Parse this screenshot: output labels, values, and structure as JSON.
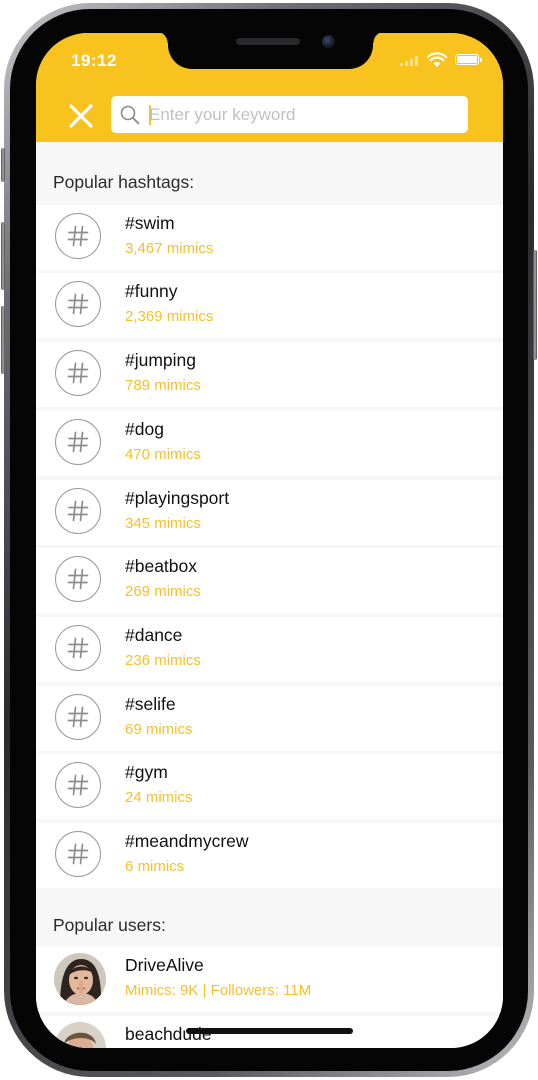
{
  "status_bar": {
    "time": "19:12"
  },
  "search": {
    "placeholder": "Enter your keyword"
  },
  "icons": {
    "close": "close-icon",
    "search": "search-icon",
    "hashtag": "hashtag-icon",
    "wifi": "wifi-icon",
    "battery": "battery-icon",
    "signal": "cellular-signal-icon"
  },
  "colors": {
    "accent": "#f8c21f",
    "count_text": "#f4c02c",
    "background": "#f7f7f7"
  },
  "hashtags_section": {
    "title": "Popular hashtags:"
  },
  "hashtags": [
    {
      "tag": "#swim",
      "count": "3,467 mimics"
    },
    {
      "tag": "#funny",
      "count": "2,369 mimics"
    },
    {
      "tag": "#jumping",
      "count": "789 mimics"
    },
    {
      "tag": "#dog",
      "count": "470 mimics"
    },
    {
      "tag": "#playingsport",
      "count": "345 mimics"
    },
    {
      "tag": "#beatbox",
      "count": "269 mimics"
    },
    {
      "tag": "#dance",
      "count": "236 mimics"
    },
    {
      "tag": "#selife",
      "count": "69 mimics"
    },
    {
      "tag": "#gym",
      "count": "24 mimics"
    },
    {
      "tag": "#meandmycrew",
      "count": "6 mimics"
    }
  ],
  "users_section": {
    "title": "Popular users:"
  },
  "users": [
    {
      "name": "DriveAlive",
      "stats": "Mimics: 9K | Followers: 11M"
    },
    {
      "name": "beachdude",
      "stats": ""
    }
  ]
}
